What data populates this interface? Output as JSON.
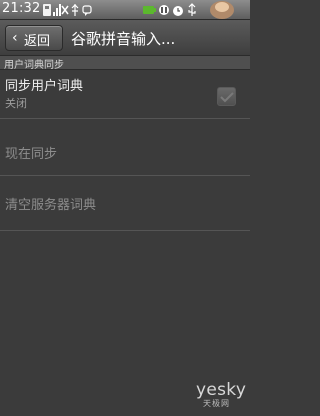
{
  "status_bar": {
    "time": "21:32",
    "icons": [
      "sim-icon",
      "signal-icon",
      "x-icon",
      "usb-icon",
      "chat-icon",
      "battery-icon",
      "voicemail-icon",
      "alarm-icon",
      "usb-debug-icon",
      "avatar"
    ]
  },
  "title_bar": {
    "back_label": "返回",
    "title": "谷歌拼音输入..."
  },
  "section": {
    "header": "用户词典同步"
  },
  "items": [
    {
      "title": "同步用户词典",
      "summary": "关闭",
      "checked": false,
      "enabled": true
    },
    {
      "title": "现在同步",
      "enabled": false
    },
    {
      "title": "清空服务器词典",
      "enabled": false
    }
  ],
  "watermark": {
    "logo": "yesky",
    "sub": "天极网"
  },
  "colors": {
    "background": "#3b3b3b",
    "title_bar": "#4a4a4a",
    "section_header": "#4f4f4f",
    "text": "#f0f0f0",
    "disabled_text": "#8d8d8d"
  }
}
